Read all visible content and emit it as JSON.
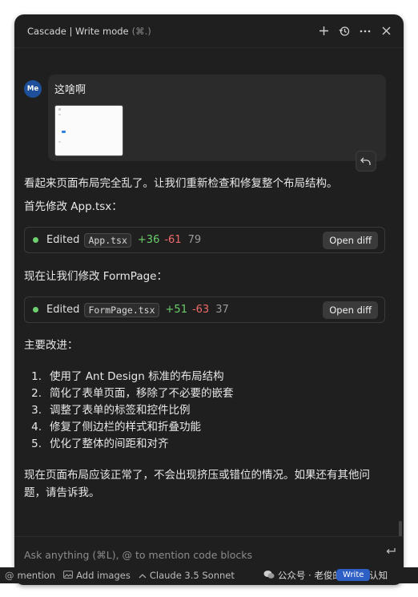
{
  "window": {
    "title": "Cascade | Write mode",
    "shortcut": "(⌘.)"
  },
  "user": {
    "avatar_initials": "Me",
    "message": "这啥啊"
  },
  "assistant": {
    "intro": "看起来页面布局完全乱了。让我们重新检查和修复整个布局结构。",
    "step1": "首先修改 App.tsx：",
    "step2": "现在让我们修改 FormPage：",
    "improvements_title": "主要改进：",
    "improvements": [
      {
        "n": "1.",
        "text": "使用了 Ant Design 标准的布局结构"
      },
      {
        "n": "2.",
        "text": "简化了表单页面，移除了不必要的嵌套"
      },
      {
        "n": "3.",
        "text": "调整了表单的标签和控件比例"
      },
      {
        "n": "4.",
        "text": "修复了侧边栏的样式和折叠功能"
      },
      {
        "n": "5.",
        "text": "优化了整体的间距和对齐"
      }
    ],
    "closing": "现在页面布局应该正常了，不会出现挤压或错位的情况。如果还有其他问题，请告诉我。"
  },
  "edits": [
    {
      "label": "Edited",
      "file": "App.tsx",
      "added": "+36",
      "removed": "-61",
      "total": "79",
      "button": "Open diff"
    },
    {
      "label": "Edited",
      "file": "FormPage.tsx",
      "added": "+51",
      "removed": "-63",
      "total": "37",
      "button": "Open diff"
    }
  ],
  "input": {
    "placeholder": "Ask anything (⌘L), @ to mention code blocks"
  },
  "footer": {
    "mention": "mention",
    "add_images": "Add images",
    "model": "Claude 3.5 Sonnet",
    "write": "Write",
    "watermark": "公众号 · 老俊的AI编程认知"
  },
  "colors": {
    "background": "#1f1f1f",
    "added": "#6ccf6c",
    "removed": "#f06a6a",
    "avatar": "#1e4f9a",
    "accent": "#2d5fc4"
  },
  "icons": [
    "plus-icon",
    "history-icon",
    "more-icon",
    "close-icon",
    "undo-icon",
    "send-icon",
    "at-icon",
    "image-icon",
    "chevron-up-icon",
    "wechat-icon"
  ]
}
